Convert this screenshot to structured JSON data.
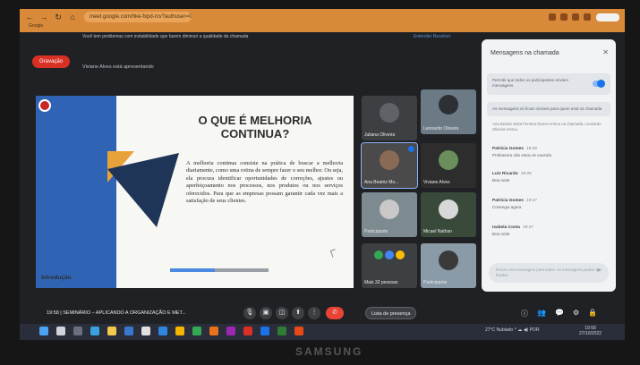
{
  "browser": {
    "url": "meet.google.com/hke-fxpd-rcv?authuser=0",
    "bookmark": "Google"
  },
  "meet": {
    "notice": "Você tem problemas com instabilidade que fazem diminuir a qualidade da chamada",
    "notice_actions": "Entender   Resolver",
    "rec_label": "Gravação",
    "presenting": "Viviane Alves está apresentando"
  },
  "slide": {
    "title": "O QUE É MELHORIA CONTINUA?",
    "body": "A melhoria continua consiste na prática de buscar a melhoria diariamente, como uma rotina de sempre fazer o seu melhor. Ou seja, ela procura identificar oportunidades de correções, ajustes ou aperfeiçoamento nos processos, nos produtos ou nos serviços oferecidos. Para que as empresas possam garantir cada vez mais a satisfação de seus clientes.",
    "footer": "Introdução",
    "progress": 0.45
  },
  "participants": [
    {
      "name": "Juliana Oliveira"
    },
    {
      "name": "Leonardo Oliveira"
    },
    {
      "name": "Ana Beatriz Mo..."
    },
    {
      "name": "Viviane Alves"
    },
    {
      "name": "Participante"
    },
    {
      "name": "Micael Nathan"
    },
    {
      "name": "Mais 32 pessoas"
    },
    {
      "name": "Participante"
    }
  ],
  "chat": {
    "title": "Mensagens na chamada",
    "toggle_label": "Permitir que todos os participantes enviem mensagens",
    "info": "As mensagens só ficam visíveis para quem está na chamada",
    "note": "Ana Beatriz Mota Ferreira Nunes entrou na chamada. Leonardo Oliveira entrou.",
    "messages": [
      {
        "who": "Patrícia Gomes",
        "when": "19:26",
        "text": "Professora não estou te ouvindo"
      },
      {
        "who": "Luiz Ricardo",
        "when": "19:26",
        "text": "Boa noite"
      },
      {
        "who": "Patrícia Gomes",
        "when": "19:27",
        "text": "Consegui agora"
      },
      {
        "who": "Isabela Costa",
        "when": "19:27",
        "text": "Boa noite"
      }
    ],
    "input_placeholder": "Enviar uma mensagem para todos. As mensagens podem ser fixadas"
  },
  "bottom": {
    "time_title": "19:58  |  SEMINÁRIO – APLICANDO A ORGANIZAÇÃO E MET...",
    "presence_label": "Lista de presença"
  },
  "taskbar": {
    "tray": "27°C Nublado  ^  ☁ ◀) POR",
    "clock": "19:58",
    "date": "27/10/2022"
  },
  "brand": "SAMSUNG",
  "colors": {
    "accent": "#1a73e8",
    "end_call": "#ea4335",
    "slide_blue": "#2f64b5",
    "slide_orange": "#e8a23a"
  }
}
